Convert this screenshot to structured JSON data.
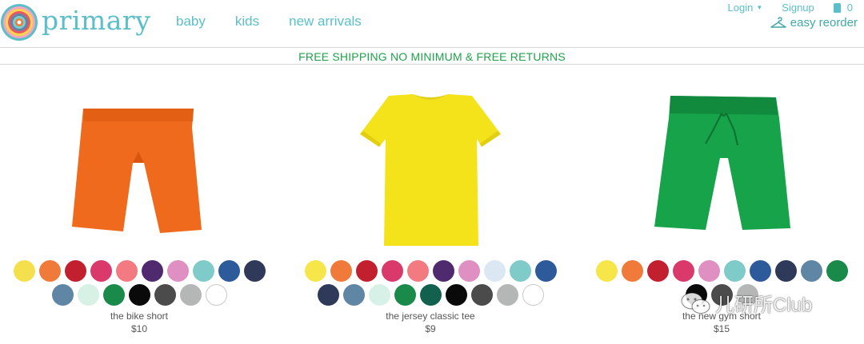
{
  "brand": {
    "name": "primary"
  },
  "nav": {
    "items": [
      "baby",
      "kids",
      "new arrivals"
    ]
  },
  "header_utils": {
    "login": "Login",
    "signup": "Signup",
    "cart_count": "0",
    "reorder": "easy reorder"
  },
  "promo": {
    "text": "FREE SHIPPING NO MINIMUM & FREE RETURNS"
  },
  "products": [
    {
      "name": "the bike short",
      "price": "$10",
      "image_icon": "orange-bike-short",
      "swatches": [
        "#f4e04d",
        "#f07a3a",
        "#c3202f",
        "#d93a6b",
        "#f47a82",
        "#4f2a6e",
        "#e08fc3",
        "#7fcbc9",
        "#2d5a9b",
        "#2f3a5a",
        "#5f86a4",
        "#d7f1e6",
        "#1a8a4a",
        "#0a0a0a",
        "#4b4b4b",
        "#b4b7b6",
        "#ffffff"
      ]
    },
    {
      "name": "the jersey classic tee",
      "price": "$9",
      "image_icon": "yellow-tee",
      "swatches": [
        "#f6e64a",
        "#f07a3a",
        "#c3202f",
        "#d93a6b",
        "#f47a82",
        "#4f2a6e",
        "#e08fc3",
        "#dbe7f2",
        "#7fcbc9",
        "#2d5a9b",
        "#2f3a5a",
        "#5f86a4",
        "#d7f1e6",
        "#1a8a4a",
        "#12614f",
        "#0a0a0a",
        "#4b4b4b",
        "#b4b7b6",
        "#ffffff"
      ]
    },
    {
      "name": "the new gym short",
      "price": "$15",
      "image_icon": "green-gym-short",
      "swatches": [
        "#f6e64a",
        "#f07a3a",
        "#c3202f",
        "#d93a6b",
        "#e08fc3",
        "#7fcbc9",
        "#2d5a9b",
        "#2f3a5a",
        "#5f86a4",
        "#1a8a4a",
        "#0a0a0a",
        "#4b4b4b",
        "#b4b7b6"
      ]
    }
  ],
  "watermark": {
    "text": "儿研所Club"
  },
  "colors": {
    "accent": "#5bbfc9",
    "promo": "#1fa24a"
  }
}
